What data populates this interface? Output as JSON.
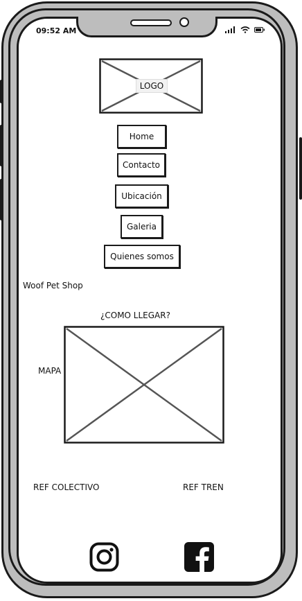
{
  "status_bar": {
    "time": "09:52 AM"
  },
  "header": {
    "logo_label": "LOGO"
  },
  "nav": {
    "items": [
      {
        "label": "Home"
      },
      {
        "label": "Contacto"
      },
      {
        "label": "Ubicación"
      },
      {
        "label": "Galeria"
      },
      {
        "label": "Quienes somos"
      }
    ]
  },
  "main": {
    "shop_name": "Woof Pet Shop",
    "section_title": "¿COMO LLEGAR?",
    "map_label": "MAPA",
    "ref_colectivo": "REF COLECTIVO",
    "ref_tren": "REF TREN"
  },
  "footer": {
    "icons": [
      "instagram-icon",
      "facebook-icon"
    ]
  }
}
